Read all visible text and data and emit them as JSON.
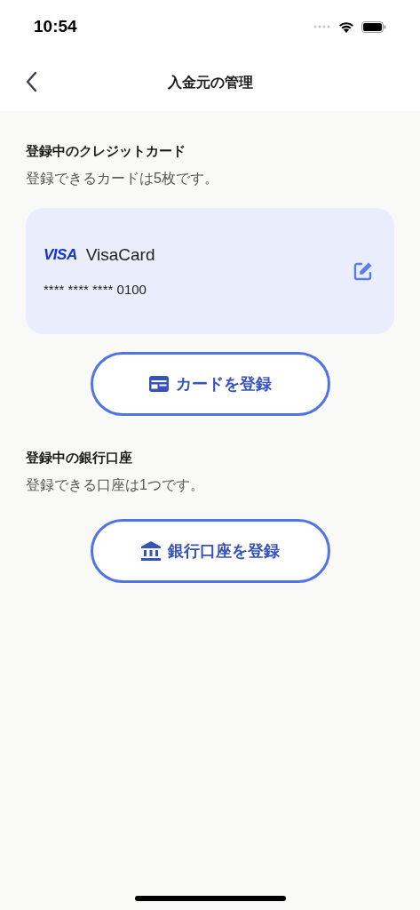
{
  "status_bar": {
    "time": "10:54"
  },
  "nav": {
    "title": "入金元の管理"
  },
  "sections": [
    {
      "kind": "cards",
      "title": "登録中のクレジットカード",
      "subtitle": "登録できるカードは5枚です。",
      "cards": [
        {
          "brand": "VISA",
          "name": "VisaCard",
          "number": "**** **** **** 0100"
        }
      ],
      "button": "カードを登録"
    },
    {
      "kind": "bank",
      "title": "登録中の銀行口座",
      "subtitle": "登録できる口座は1つです。",
      "button": "銀行口座を登録"
    }
  ]
}
